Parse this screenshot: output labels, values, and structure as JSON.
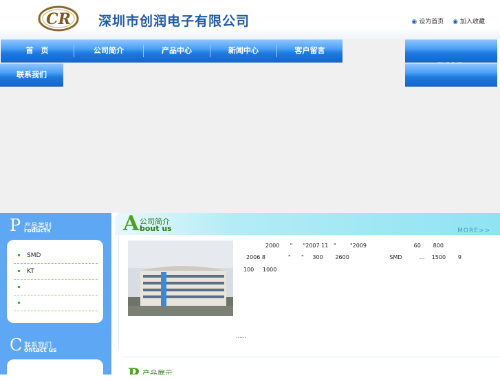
{
  "header": {
    "logo_text": "CR",
    "company_name": "深圳市创润电子有限公司",
    "links": [
      {
        "label": "设为首页"
      },
      {
        "label": "加入收藏"
      }
    ]
  },
  "nav": {
    "items": [
      {
        "label": "首　页"
      },
      {
        "label": "公司简介"
      },
      {
        "label": "产品中心"
      },
      {
        "label": "新闻中心"
      },
      {
        "label": "客户留言"
      }
    ],
    "second_row": {
      "label": "联系我们"
    },
    "faint_label": "联系我们"
  },
  "sidebar": {
    "products": {
      "letter": "P",
      "title_zh": "产品类别",
      "title_en": "roducts",
      "items": [
        {
          "label": "SMD"
        },
        {
          "label": "KT"
        },
        {
          "label": ""
        },
        {
          "label": ""
        }
      ]
    },
    "contact": {
      "letter": "C",
      "title_zh": "联系我们",
      "title_en": "ontact  us"
    }
  },
  "about": {
    "letter": "A",
    "title_zh": "公司简介",
    "title_en": "bout us",
    "more": "MORE>>",
    "lines": [
      "2000      \"      \"2007 11   \"        \"2009                           60       800",
      "2006 8             \"      \"     300       2600                       SMD          ...    1500       9",
      "100     1000"
    ],
    "ellipsis": "......"
  },
  "products_section": {
    "letter": "P",
    "title_zh": "产品展示"
  },
  "colors": {
    "brand_blue": "#1f5aa8",
    "nav_blue": "#1f7ae0",
    "sidebar_blue": "#5ea7f5",
    "accent_green": "#4fa11e",
    "banner_grey": "#f0f0f0"
  }
}
